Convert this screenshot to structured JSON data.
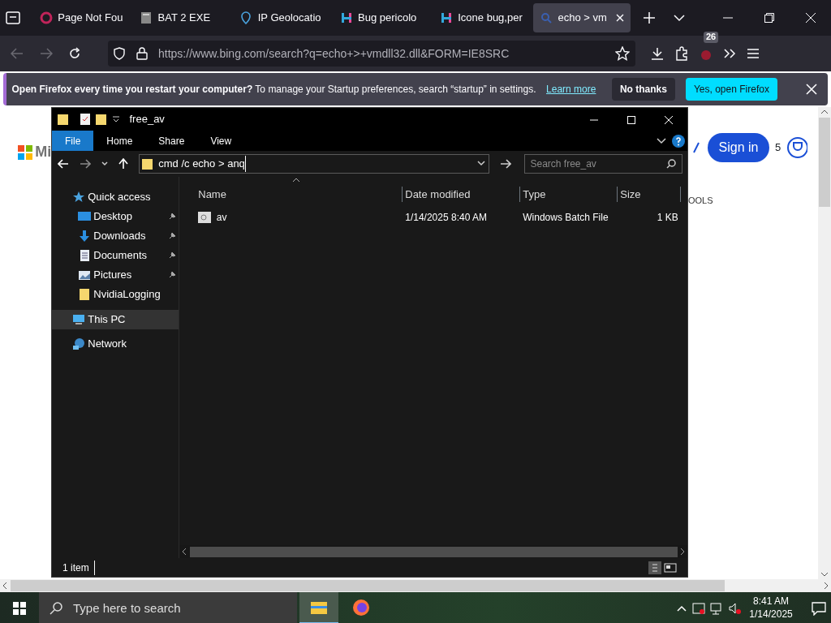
{
  "browser": {
    "tabs": [
      {
        "title": "Page Not Fou",
        "kind": "ring",
        "selected": false
      },
      {
        "title": "BAT 2 EXE",
        "kind": "doc",
        "selected": false
      },
      {
        "title": "IP Geolocatio",
        "kind": "pin",
        "selected": false
      },
      {
        "title": "Bug pericolo",
        "kind": "hlogo",
        "selected": false
      },
      {
        "title": "Icone bug,per",
        "kind": "hlogo",
        "selected": false
      },
      {
        "title": "echo > vm",
        "kind": "search",
        "selected": true
      }
    ],
    "url": "https://www.bing.com/search?q=echo+>+vmdll32.dll&FORM=IE8SRC",
    "extension_badge": "26",
    "notification": {
      "message": "**Open Firefox every time you restart your computer?** To manage your Startup preferences, search “startup” in settings.",
      "link": "Learn more",
      "buttons": [
        "No thanks",
        "Yes, open Firefox"
      ]
    },
    "page": {
      "logo_text": "Mi",
      "sign_in": "Sign in",
      "points": "5",
      "tools_fragment": "OOLS"
    }
  },
  "explorer": {
    "title": "free_av",
    "ribbon_tabs": [
      {
        "label": "File",
        "selected": true
      },
      {
        "label": "Home",
        "selected": false
      },
      {
        "label": "Share",
        "selected": false
      },
      {
        "label": "View",
        "selected": false
      }
    ],
    "address": "cmd /c echo > anq",
    "search_placeholder": "Search free_av",
    "nav": [
      {
        "label": "Quick access",
        "kind": "star",
        "selected": false,
        "children": [
          {
            "label": "Desktop",
            "kind": "desktop",
            "pinned": true
          },
          {
            "label": "Downloads",
            "kind": "download",
            "pinned": true
          },
          {
            "label": "Documents",
            "kind": "document",
            "pinned": true
          },
          {
            "label": "Pictures",
            "kind": "picture",
            "pinned": true
          },
          {
            "label": "NvidiaLogging",
            "kind": "folder",
            "pinned": false
          }
        ]
      },
      {
        "label": "This PC",
        "kind": "pc",
        "selected": true
      },
      {
        "label": "Network",
        "kind": "network",
        "selected": false
      }
    ],
    "columns": [
      "Name",
      "Date modified",
      "Type",
      "Size"
    ],
    "rows": [
      {
        "name": "av",
        "date": "1/14/2025 8:40 AM",
        "type": "Windows Batch File",
        "size": "1 KB"
      }
    ],
    "status": "1 item"
  },
  "taskbar": {
    "search_placeholder": "Type here to search",
    "apps": [
      {
        "kind": "explorer",
        "selected": true
      },
      {
        "kind": "firefox",
        "selected": false
      }
    ],
    "time": "8:41 AM",
    "date": "1/14/2025"
  }
}
